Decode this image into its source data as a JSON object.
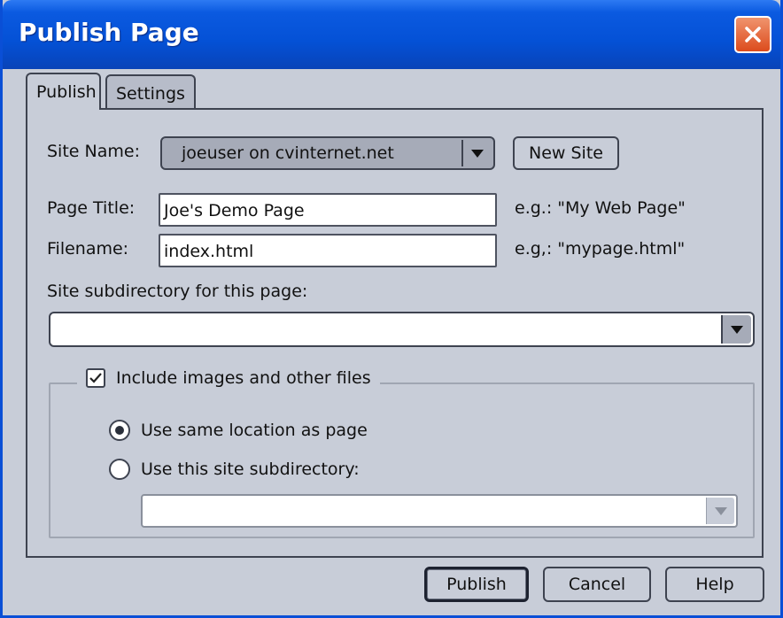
{
  "window": {
    "title": "Publish Page"
  },
  "tabs": [
    {
      "label": "Publish"
    },
    {
      "label": "Settings"
    }
  ],
  "site_name": {
    "label": "Site Name:",
    "value": "joeuser on cvinternet.net",
    "new_site_button": "New Site"
  },
  "page_title": {
    "label": "Page Title:",
    "value": "Joe's Demo Page",
    "hint": "e.g.: \"My Web Page\""
  },
  "filename": {
    "label": "Filename:",
    "value": "index.html",
    "hint": "e.g,: \"mypage.html\""
  },
  "subdirectory": {
    "label": "Site subdirectory for this page:",
    "value": ""
  },
  "include_files": {
    "label": "Include images and other files",
    "checked": true,
    "options": [
      {
        "label": "Use same location as page",
        "selected": true
      },
      {
        "label": "Use this site subdirectory:",
        "selected": false
      }
    ],
    "subdirectory_value": ""
  },
  "buttons": {
    "publish": "Publish",
    "cancel": "Cancel",
    "help": "Help"
  },
  "colors": {
    "titlebar": "#0451d6",
    "close": "#dc4b1c",
    "panel": "#c8cdd8"
  },
  "icons": {
    "close": "close-icon",
    "dropdown": "chevron-down-icon",
    "check": "check-icon"
  }
}
